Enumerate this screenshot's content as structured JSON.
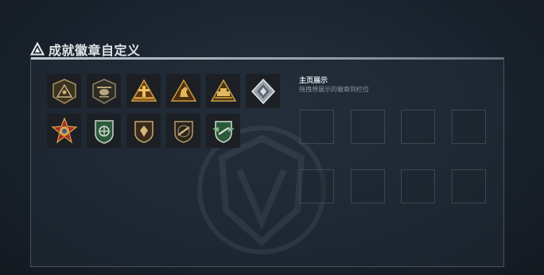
{
  "page": {
    "title": "成就徽章自定义"
  },
  "display": {
    "title": "主页展示",
    "subtitle": "拖拽想展示的徽章到栏位"
  },
  "badges": [
    {
      "name": "pyramid-eye-badge",
      "bg": "#1c2024"
    },
    {
      "name": "helicopter-badge",
      "bg": "#1c2024"
    },
    {
      "name": "tower-triangle-badge",
      "bg": "#1c2024"
    },
    {
      "name": "horse-triangle-badge",
      "bg": "#1c2024"
    },
    {
      "name": "vehicle-triangle-badge",
      "bg": "#1c2024"
    },
    {
      "name": "silver-diamond-badge",
      "bg": "#1c2024"
    },
    {
      "name": "red-star-medal-badge",
      "bg": "#1c2024"
    },
    {
      "name": "green-shield-badge",
      "bg": "#1c2024"
    },
    {
      "name": "shield-emblem-badge",
      "bg": "#1c2024"
    },
    {
      "name": "rifle-shield-badge",
      "bg": "#1c2024"
    },
    {
      "name": "green-wings-shield-badge",
      "bg": "#1c2024"
    }
  ],
  "slots_count": 8
}
